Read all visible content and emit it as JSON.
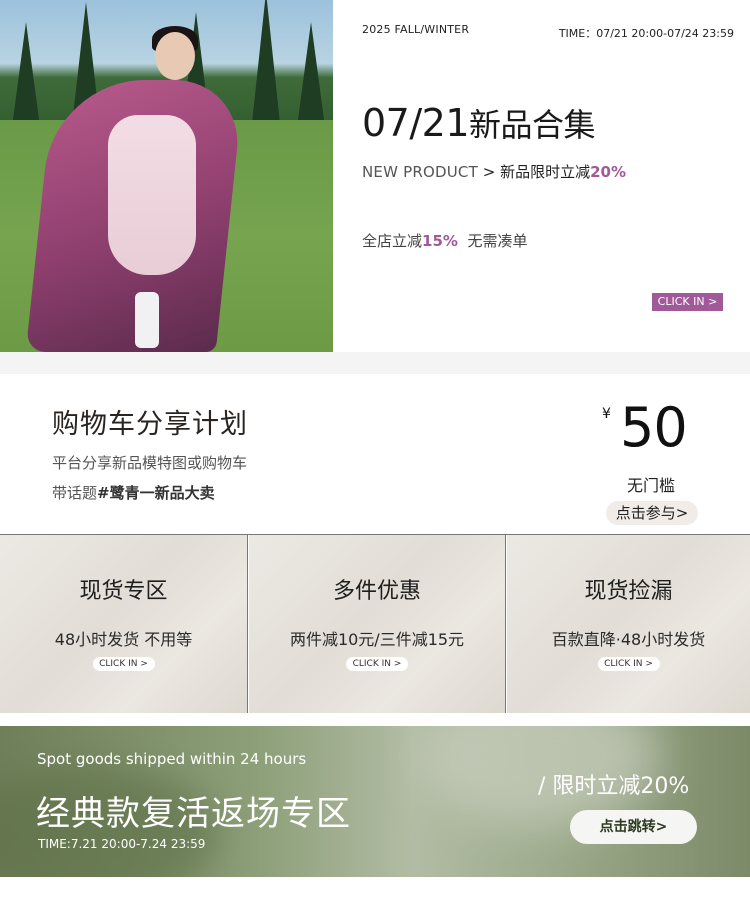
{
  "hero": {
    "season": "2025 FALL/WINTER",
    "time": "TIME：07/21 20:00-07/24 23:59",
    "title_date": "07/21",
    "title_cn": "新品合集",
    "sub_en": "NEW PRODUCT",
    "sub_arrow": " > ",
    "sub_cn": "新品限时立减",
    "sub_pct": "20%",
    "store_text": "全店立减",
    "store_pct": "15%",
    "store_note": "无需凑单",
    "click": "CLICK IN >"
  },
  "share": {
    "title": "购物车分享计划",
    "line1": "平台分享新品模特图或购物车",
    "line2_prefix": "带话题",
    "line2_topic": "#鹭青一新品大卖",
    "coupon_currency": "¥",
    "coupon_amount": "50",
    "coupon_note": "无门槛",
    "coupon_button": "点击参与>"
  },
  "zones": [
    {
      "title": "现货专区",
      "desc": "48小时发货 不用等",
      "click": "CLICK IN >"
    },
    {
      "title": "多件优惠",
      "desc": "两件减10元/三件减15元",
      "click": "CLICK IN >"
    },
    {
      "title": "现货捡漏",
      "desc": "百款直降·48小时发货",
      "click": "CLICK IN >"
    }
  ],
  "classic": {
    "en": "Spot goods shipped within 24 hours",
    "title": "经典款复活返场专区",
    "time": "TIME:7.21 20:00-7.24 23:59",
    "discount": "/ 限时立减20%",
    "button": "点击跳转>"
  },
  "colors": {
    "accent": "#a05a99",
    "banner_green": "#8ea07a"
  }
}
